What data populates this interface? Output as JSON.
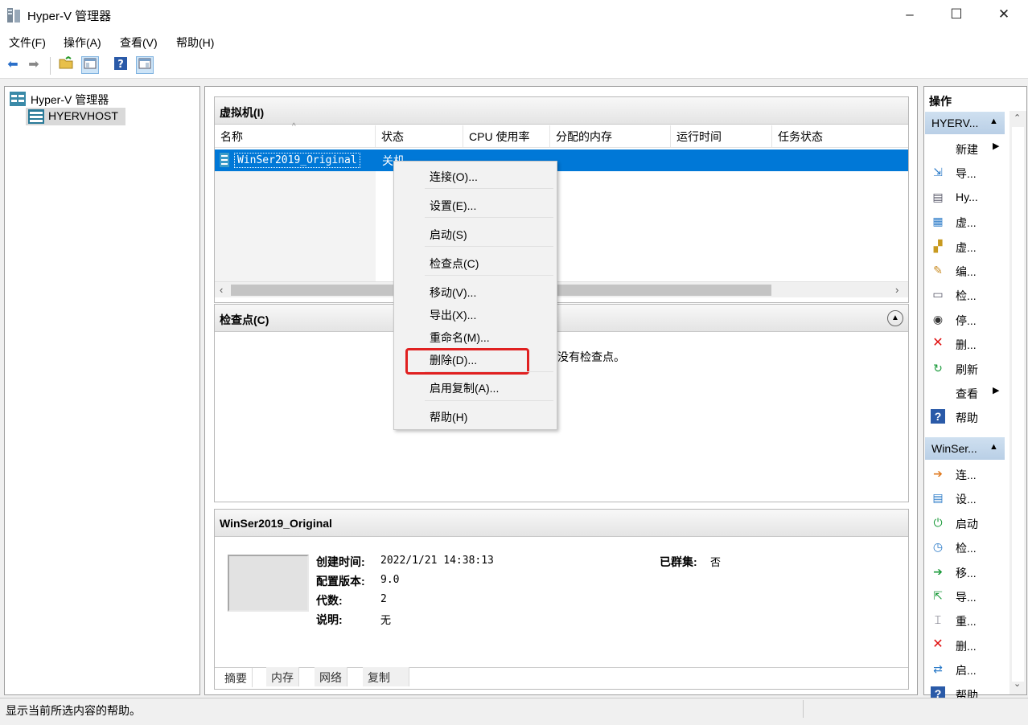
{
  "window": {
    "title": "Hyper-V 管理器",
    "minimize": "–",
    "maximize": "☐",
    "close": "✕"
  },
  "menu": [
    "文件(F)",
    "操作(A)",
    "查看(V)",
    "帮助(H)"
  ],
  "nav": {
    "root": "Hyper-V 管理器",
    "host": "HYERVHOST"
  },
  "vm_section": {
    "title": "虚拟机(I)",
    "columns": [
      "名称",
      "状态",
      "CPU 使用率",
      "分配的内存",
      "运行时间",
      "任务状态"
    ],
    "rows": [
      {
        "name": "WinSer2019_Original",
        "state": "关机"
      }
    ]
  },
  "context_menu": [
    "连接(O)...",
    "设置(E)...",
    "启动(S)",
    "检查点(C)",
    "移动(V)...",
    "导出(X)...",
    "重命名(M)...",
    "删除(D)...",
    "启用复制(A)...",
    "帮助(H)"
  ],
  "checkpoint_section": {
    "title": "检查点(C)",
    "empty_text": "没有检查点。"
  },
  "details": {
    "title": "WinSer2019_Original",
    "created_label": "创建时间:",
    "created_value": "2022/1/21 14:38:13",
    "config_label": "配置版本:",
    "config_value": "9.0",
    "gen_label": "代数:",
    "gen_value": "2",
    "desc_label": "说明:",
    "desc_value": "无",
    "cluster_label": "已群集:",
    "cluster_value": "否",
    "tabs": [
      "摘要",
      "内存",
      "网络",
      "复制"
    ]
  },
  "actions": {
    "header": "操作",
    "group1": "HYERV...",
    "group1_items": [
      {
        "icon": "new-icon",
        "label": "新建"
      },
      {
        "icon": "import-icon",
        "label": "导..."
      },
      {
        "icon": "settings-icon",
        "label": "Hy..."
      },
      {
        "icon": "switch-manager-icon",
        "label": "虚..."
      },
      {
        "icon": "san-manager-icon",
        "label": "虚..."
      },
      {
        "icon": "edit-disk-icon",
        "label": "编..."
      },
      {
        "icon": "inspect-disk-icon",
        "label": "检..."
      },
      {
        "icon": "stop-service-icon",
        "label": "停..."
      },
      {
        "icon": "delete-icon",
        "label": "删..."
      },
      {
        "icon": "refresh-icon",
        "label": "刷新"
      },
      {
        "icon": "view-icon",
        "label": "查看"
      },
      {
        "icon": "help-icon",
        "label": "帮助"
      }
    ],
    "group2": "WinSer...",
    "group2_items": [
      {
        "icon": "connect-icon",
        "label": "连..."
      },
      {
        "icon": "vm-settings-icon",
        "label": "设..."
      },
      {
        "icon": "start-icon",
        "label": "启动"
      },
      {
        "icon": "checkpoint-icon",
        "label": "检..."
      },
      {
        "icon": "move-icon",
        "label": "移..."
      },
      {
        "icon": "export-icon",
        "label": "导..."
      },
      {
        "icon": "rename-icon",
        "label": "重..."
      },
      {
        "icon": "delete-vm-icon",
        "label": "删..."
      },
      {
        "icon": "replication-icon",
        "label": "启..."
      },
      {
        "icon": "help-icon",
        "label": "帮助"
      }
    ]
  },
  "status_bar": "显示当前所选内容的帮助。",
  "colors": {
    "selection": "#0078d7",
    "highlight_box": "#e02020",
    "action_header": "#bfd3ea"
  }
}
